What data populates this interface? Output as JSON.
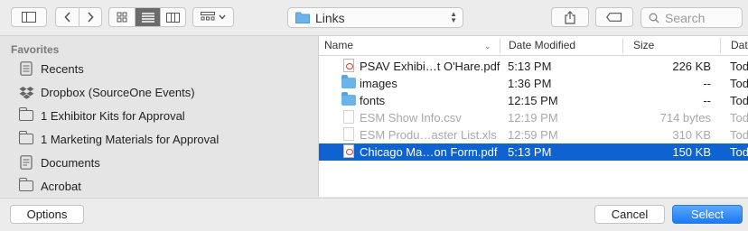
{
  "toolbar": {
    "path_label": "Links",
    "search_placeholder": "Search"
  },
  "sidebar": {
    "heading": "Favorites",
    "items": [
      {
        "label": "Recents",
        "icon": "recents-icon"
      },
      {
        "label": "Dropbox (SourceOne Events)",
        "icon": "dropbox-icon"
      },
      {
        "label": "1 Exhibitor Kits for Approval",
        "icon": "folder-icon"
      },
      {
        "label": "1 Marketing Materials for Approval",
        "icon": "folder-icon"
      },
      {
        "label": "Documents",
        "icon": "documents-icon"
      },
      {
        "label": "Acrobat",
        "icon": "folder-icon"
      }
    ]
  },
  "columns": {
    "name": "Name",
    "date": "Date Modified",
    "size": "Size",
    "kind": "Dat"
  },
  "files": [
    {
      "name": "PSAV Exhibi…t O'Hare.pdf",
      "date": "5:13 PM",
      "size": "226 KB",
      "kind": "Tod",
      "icon": "pdf-icon"
    },
    {
      "name": "images",
      "date": "1:36 PM",
      "size": "--",
      "kind": "Tod",
      "icon": "folder-icon"
    },
    {
      "name": "fonts",
      "date": "12:15 PM",
      "size": "--",
      "kind": "Tod",
      "icon": "folder-icon"
    },
    {
      "name": "ESM Show Info.csv",
      "date": "12:19 PM",
      "size": "714 bytes",
      "kind": "Tod",
      "icon": "document-icon"
    },
    {
      "name": "ESM Produ…aster List.xls",
      "date": "12:59 PM",
      "size": "310 KB",
      "kind": "Tod",
      "icon": "spreadsheet-icon"
    },
    {
      "name": "Chicago Ma…on Form.pdf",
      "date": "5:13 PM",
      "size": "150 KB",
      "kind": "Tod",
      "icon": "pdf-icon"
    }
  ],
  "buttons": {
    "options": "Options",
    "cancel": "Cancel",
    "select": "Select"
  },
  "colors": {
    "selection": "#0f63d0",
    "primary_button": "#1e7af3",
    "folder": "#6cb3ea"
  }
}
